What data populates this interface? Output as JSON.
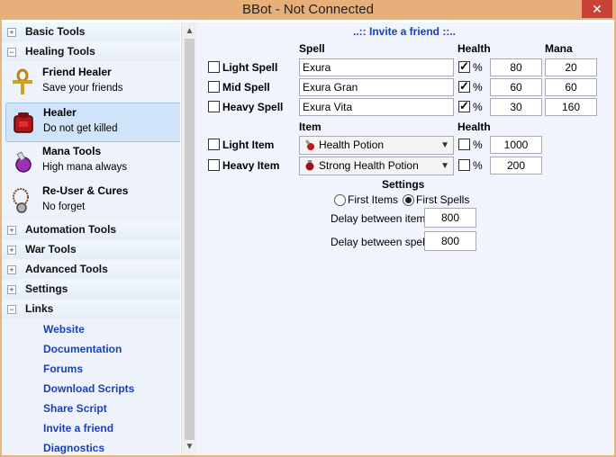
{
  "window": {
    "title": "BBot - Not Connected",
    "close_glyph": "✕"
  },
  "sidebar": {
    "categories": {
      "basic_tools": "Basic Tools",
      "healing_tools": "Healing Tools",
      "automation_tools": "Automation Tools",
      "war_tools": "War Tools",
      "advanced_tools": "Advanced Tools",
      "settings": "Settings",
      "links": "Links"
    },
    "tools": [
      {
        "name": "Friend Healer",
        "desc": "Save your friends",
        "icon": "ankh-icon"
      },
      {
        "name": "Healer",
        "desc": "Do not get killed",
        "icon": "red-backpack-icon"
      },
      {
        "name": "Mana Tools",
        "desc": "High mana always",
        "icon": "mana-potion-icon"
      },
      {
        "name": "Re-User & Cures",
        "desc": "No forget",
        "icon": "amulet-icon"
      }
    ],
    "links": [
      "Website",
      "Documentation",
      "Forums",
      "Download Scripts",
      "Share Script",
      "Invite a friend",
      "Diagnostics"
    ]
  },
  "main": {
    "invite_link": "..:: Invite a friend ::..",
    "headers": {
      "spell": "Spell",
      "health": "Health",
      "mana": "Mana",
      "item": "Item",
      "item_health": "Health",
      "settings": "Settings"
    },
    "spells": [
      {
        "label": "Light Spell",
        "spell": "Exura",
        "health_checked": true,
        "health": "80",
        "mana": "20"
      },
      {
        "label": "Mid Spell",
        "spell": "Exura Gran",
        "health_checked": true,
        "health": "60",
        "mana": "60"
      },
      {
        "label": "Heavy Spell",
        "spell": "Exura Vita",
        "health_checked": true,
        "health": "30",
        "mana": "160"
      }
    ],
    "items": [
      {
        "label": "Light Item",
        "item": "Health Potion",
        "health_checked": false,
        "health": "1000"
      },
      {
        "label": "Heavy Item",
        "item": "Strong Health Potion",
        "health_checked": false,
        "health": "200"
      }
    ],
    "pct": "%",
    "settings": {
      "radio_first_items": "First Items",
      "radio_first_spells": "First Spells",
      "selected": "First Spells",
      "delay_items_label": "Delay between items",
      "delay_items_value": "800",
      "delay_spells_label": "Delay between spells",
      "delay_spells_value": "800"
    }
  },
  "scrollbar": {
    "up": "▲",
    "down": "▼"
  },
  "colors": {
    "accent": "#1a3fb8",
    "titlebar": "#e7b07a",
    "close": "#c7433a",
    "panel": "#f1f4fd"
  }
}
